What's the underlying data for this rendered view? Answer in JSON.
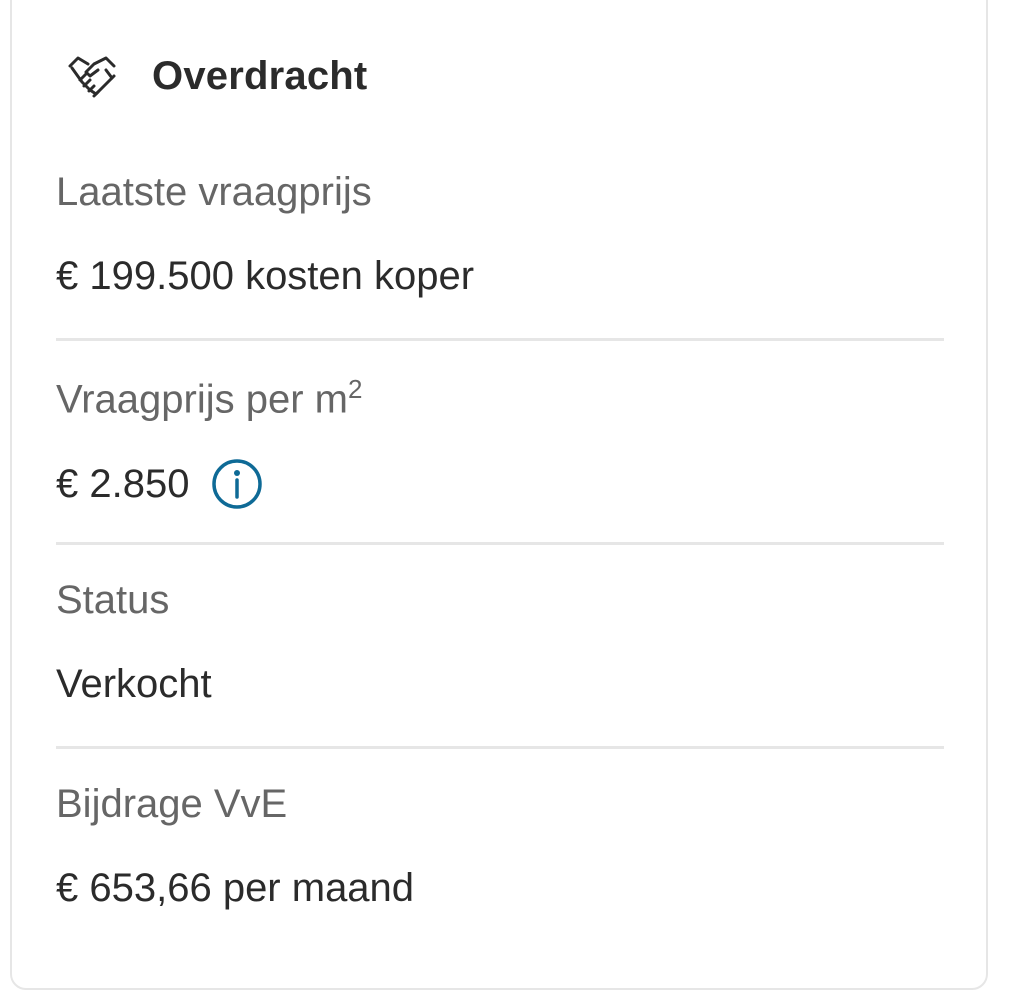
{
  "section": {
    "title": "Overdracht",
    "icon": "handshake-icon"
  },
  "rows": [
    {
      "label": "Laatste vraagprijs",
      "value": "€ 199.500 kosten koper"
    },
    {
      "label": "Vraagprijs per m",
      "label_sup": "2",
      "value": "€ 2.850",
      "value_icon": "info-icon"
    },
    {
      "label": "Status",
      "value": "Verkocht"
    },
    {
      "label": "Bijdrage VvE",
      "value": "€ 653,66 per maand"
    }
  ],
  "colors": {
    "accent": "#0e6a96",
    "label": "#666666",
    "value": "#2b2b2b",
    "divider": "#e6e6e6"
  }
}
